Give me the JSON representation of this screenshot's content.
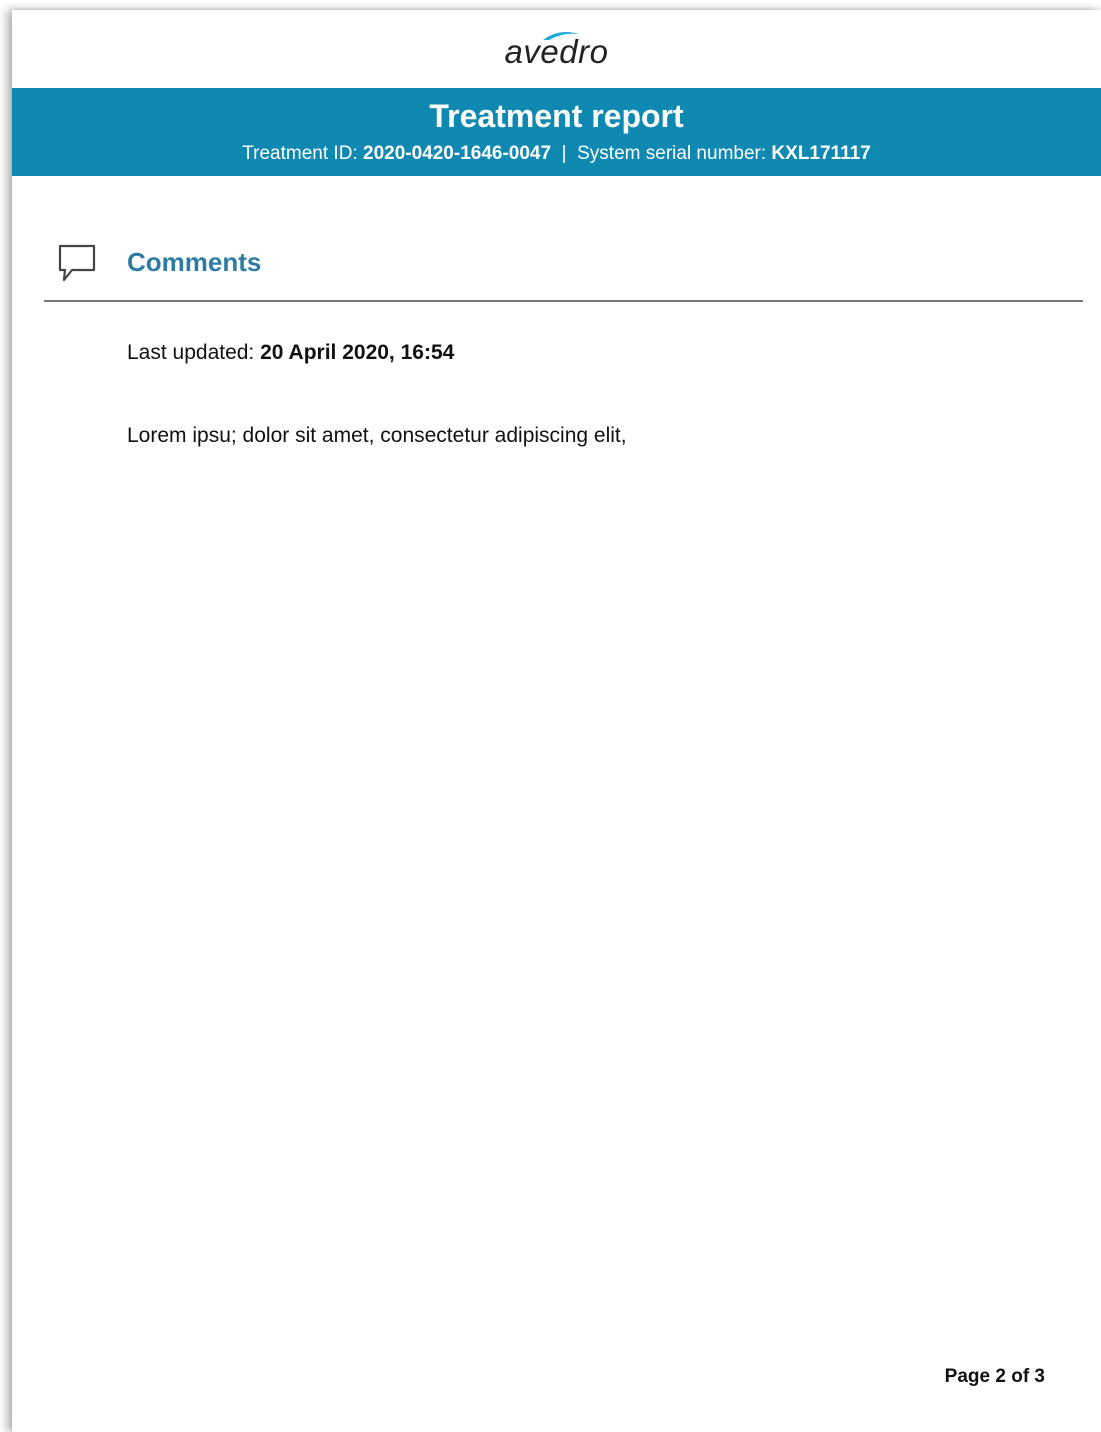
{
  "logo": {
    "text": "avedro",
    "accent_color": "#1fa9d6"
  },
  "header": {
    "title": "Treatment report",
    "treatment_id_label": "Treatment ID:",
    "treatment_id": "2020-0420-1646-0047",
    "separator": "|",
    "serial_label": "System serial number:",
    "serial_number": "KXL171117",
    "band_color": "#0f89b2"
  },
  "section": {
    "icon": "comment-icon",
    "title": "Comments",
    "title_color": "#2e7ca3"
  },
  "last_updated": {
    "label": "Last updated:",
    "value": "20 April 2020, 16:54"
  },
  "comment": {
    "text": "Lorem ipsu; dolor sit amet, consectetur adipiscing elit,"
  },
  "footer": {
    "page_label": "Page 2 of 3"
  }
}
